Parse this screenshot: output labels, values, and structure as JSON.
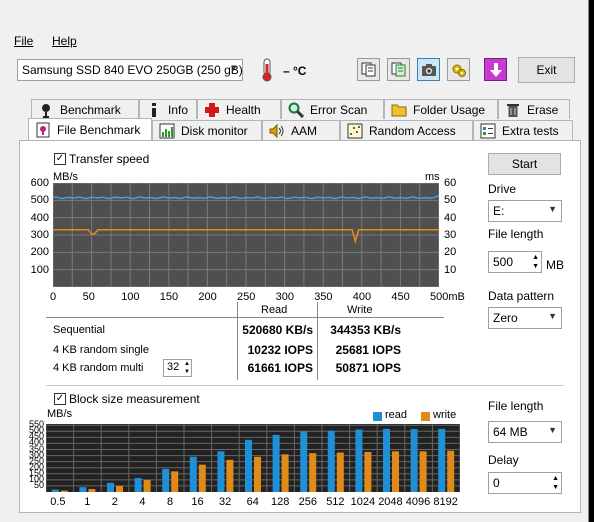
{
  "menu": {
    "file": "File",
    "help": "Help"
  },
  "drive_select": {
    "value": "Samsung SSD 840 EVO 250GB (250 gB)"
  },
  "temperature": {
    "value": "– °C"
  },
  "toolbar": {
    "exit_label": "Exit"
  },
  "tabs_top": [
    {
      "label": "Benchmark",
      "icon": "benchmark-icon"
    },
    {
      "label": "Info",
      "icon": "info-icon"
    },
    {
      "label": "Health",
      "icon": "health-cross-icon"
    },
    {
      "label": "Error Scan",
      "icon": "magnifier-icon"
    },
    {
      "label": "Folder Usage",
      "icon": "folder-icon"
    },
    {
      "label": "Erase",
      "icon": "trash-icon"
    }
  ],
  "tabs_bottom": [
    {
      "label": "File Benchmark",
      "icon": "file-benchmark-icon"
    },
    {
      "label": "Disk monitor",
      "icon": "disk-monitor-icon"
    },
    {
      "label": "AAM",
      "icon": "speaker-icon"
    },
    {
      "label": "Random Access",
      "icon": "random-access-icon"
    },
    {
      "label": "Extra tests",
      "icon": "extra-tests-icon"
    }
  ],
  "transfer": {
    "checkbox_label": "Transfer speed",
    "checked": true,
    "left_unit": "MB/s",
    "right_unit": "ms"
  },
  "right_panel": {
    "start_label": "Start",
    "drive_label": "Drive",
    "drive_value": "E:",
    "file_length_label": "File length",
    "file_length_value": "500",
    "file_length_unit": "MB",
    "data_pattern_label": "Data pattern",
    "data_pattern_value": "Zero"
  },
  "results": {
    "read_header": "Read",
    "write_header": "Write",
    "rows": [
      {
        "label": "Sequential",
        "read": "520680 KB/s",
        "write": "344353 KB/s"
      },
      {
        "label": "4 KB random single",
        "read": "10232 IOPS",
        "write": "25681 IOPS"
      },
      {
        "label": "4 KB random multi",
        "read": "61661 IOPS",
        "write": "50871 IOPS"
      }
    ],
    "queue_depth": "32"
  },
  "block": {
    "checkbox_label": "Block size measurement",
    "checked": true,
    "file_length_label": "File length",
    "file_length_value": "64 MB",
    "delay_label": "Delay",
    "delay_value": "0"
  },
  "chart_data": [
    {
      "type": "line",
      "title": "Transfer speed",
      "ylabel": "MB/s",
      "y2label": "ms",
      "x_ticks": [
        "0",
        "50",
        "100",
        "150",
        "200",
        "250",
        "300",
        "350",
        "400",
        "450",
        "500mB"
      ],
      "y_ticks": [
        "600",
        "500",
        "400",
        "300",
        "200",
        "100"
      ],
      "y2_ticks": [
        "60",
        "50",
        "40",
        "30",
        "20",
        "10"
      ],
      "xlim": [
        0,
        500
      ],
      "ylim": [
        0,
        600
      ],
      "y2lim": [
        0,
        60
      ],
      "series": [
        {
          "color": "#3fa4e0",
          "x": [
            0,
            50,
            100,
            150,
            200,
            250,
            300,
            350,
            400,
            450,
            500
          ],
          "y": [
            515,
            516,
            514,
            517,
            515,
            516,
            514,
            517,
            516,
            515,
            530
          ]
        },
        {
          "color": "#e88a1a",
          "x": [
            0,
            50,
            100,
            150,
            200,
            250,
            300,
            350,
            400,
            450,
            500
          ],
          "y": [
            33,
            33,
            33,
            33,
            33,
            33,
            33,
            33,
            33,
            33,
            33
          ]
        }
      ],
      "grid": true
    },
    {
      "type": "bar",
      "title": "Block size measurement",
      "ylabel": "MB/s",
      "categories": [
        "0.5",
        "1",
        "2",
        "4",
        "8",
        "16",
        "32",
        "64",
        "128",
        "256",
        "512",
        "1024",
        "2048",
        "4096",
        "8192"
      ],
      "y_ticks": [
        "550",
        "500",
        "450",
        "400",
        "350",
        "300",
        "250",
        "200",
        "150",
        "100",
        "50"
      ],
      "ylim": [
        0,
        560
      ],
      "series": [
        {
          "name": "read",
          "color": "#1f8fd6",
          "values": [
            20,
            40,
            75,
            115,
            190,
            290,
            335,
            430,
            470,
            500,
            505,
            515,
            520,
            518,
            520
          ]
        },
        {
          "name": "write",
          "color": "#e08a1a",
          "values": [
            12,
            25,
            50,
            100,
            170,
            225,
            265,
            290,
            310,
            320,
            325,
            330,
            335,
            335,
            340
          ]
        }
      ],
      "legend": "top-right",
      "grid": true
    }
  ]
}
